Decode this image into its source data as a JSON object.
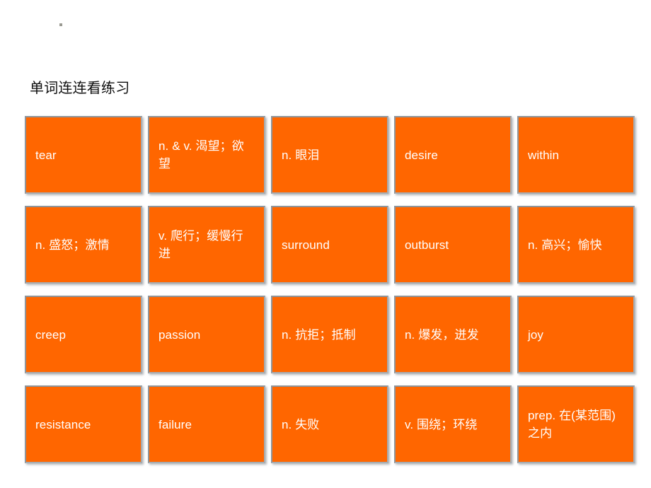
{
  "slide": {
    "background_color": "#ffffff",
    "bullet_marker": "",
    "title": "单词连连看练习"
  },
  "theme": {
    "card_fill": "#ff6600",
    "card_text_color": "#ffffff",
    "card_border_color": "#8f9499",
    "title_color": "#0d0d0d"
  },
  "grid": {
    "columns": 5,
    "rows": 4,
    "cards": [
      {
        "id": "card-r1c1",
        "text": "tear"
      },
      {
        "id": "card-r1c2",
        "text": "n. & v. 渴望；欲望"
      },
      {
        "id": "card-r1c3",
        "text": "n. 眼泪"
      },
      {
        "id": "card-r1c4",
        "text": "desire"
      },
      {
        "id": "card-r1c5",
        "text": "within"
      },
      {
        "id": "card-r2c1",
        "text": "n. 盛怒；激情"
      },
      {
        "id": "card-r2c2",
        "text": "v. 爬行；缓慢行进"
      },
      {
        "id": "card-r2c3",
        "text": "surround"
      },
      {
        "id": "card-r2c4",
        "text": "outburst"
      },
      {
        "id": "card-r2c5",
        "text": "n. 高兴；愉快"
      },
      {
        "id": "card-r3c1",
        "text": "creep"
      },
      {
        "id": "card-r3c2",
        "text": "passion"
      },
      {
        "id": "card-r3c3",
        "text": "n. 抗拒；抵制"
      },
      {
        "id": "card-r3c4",
        "text": "n. 爆发，迸发"
      },
      {
        "id": "card-r3c5",
        "text": "joy"
      },
      {
        "id": "card-r4c1",
        "text": "resistance"
      },
      {
        "id": "card-r4c2",
        "text": "failure"
      },
      {
        "id": "card-r4c3",
        "text": "n. 失败"
      },
      {
        "id": "card-r4c4",
        "text": "v. 围绕；环绕"
      },
      {
        "id": "card-r4c5",
        "text": "prep. 在(某范围)之内"
      }
    ]
  }
}
